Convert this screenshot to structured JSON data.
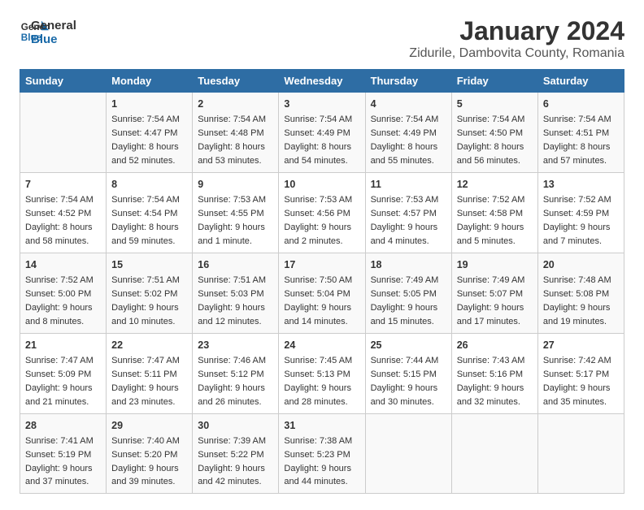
{
  "header": {
    "logo_line1": "General",
    "logo_line2": "Blue",
    "main_title": "January 2024",
    "subtitle": "Zidurile, Dambovita County, Romania"
  },
  "days_of_week": [
    "Sunday",
    "Monday",
    "Tuesday",
    "Wednesday",
    "Thursday",
    "Friday",
    "Saturday"
  ],
  "weeks": [
    [
      {
        "day": "",
        "content": ""
      },
      {
        "day": "1",
        "content": "Sunrise: 7:54 AM\nSunset: 4:47 PM\nDaylight: 8 hours\nand 52 minutes."
      },
      {
        "day": "2",
        "content": "Sunrise: 7:54 AM\nSunset: 4:48 PM\nDaylight: 8 hours\nand 53 minutes."
      },
      {
        "day": "3",
        "content": "Sunrise: 7:54 AM\nSunset: 4:49 PM\nDaylight: 8 hours\nand 54 minutes."
      },
      {
        "day": "4",
        "content": "Sunrise: 7:54 AM\nSunset: 4:49 PM\nDaylight: 8 hours\nand 55 minutes."
      },
      {
        "day": "5",
        "content": "Sunrise: 7:54 AM\nSunset: 4:50 PM\nDaylight: 8 hours\nand 56 minutes."
      },
      {
        "day": "6",
        "content": "Sunrise: 7:54 AM\nSunset: 4:51 PM\nDaylight: 8 hours\nand 57 minutes."
      }
    ],
    [
      {
        "day": "7",
        "content": "Sunrise: 7:54 AM\nSunset: 4:52 PM\nDaylight: 8 hours\nand 58 minutes."
      },
      {
        "day": "8",
        "content": "Sunrise: 7:54 AM\nSunset: 4:54 PM\nDaylight: 8 hours\nand 59 minutes."
      },
      {
        "day": "9",
        "content": "Sunrise: 7:53 AM\nSunset: 4:55 PM\nDaylight: 9 hours\nand 1 minute."
      },
      {
        "day": "10",
        "content": "Sunrise: 7:53 AM\nSunset: 4:56 PM\nDaylight: 9 hours\nand 2 minutes."
      },
      {
        "day": "11",
        "content": "Sunrise: 7:53 AM\nSunset: 4:57 PM\nDaylight: 9 hours\nand 4 minutes."
      },
      {
        "day": "12",
        "content": "Sunrise: 7:52 AM\nSunset: 4:58 PM\nDaylight: 9 hours\nand 5 minutes."
      },
      {
        "day": "13",
        "content": "Sunrise: 7:52 AM\nSunset: 4:59 PM\nDaylight: 9 hours\nand 7 minutes."
      }
    ],
    [
      {
        "day": "14",
        "content": "Sunrise: 7:52 AM\nSunset: 5:00 PM\nDaylight: 9 hours\nand 8 minutes."
      },
      {
        "day": "15",
        "content": "Sunrise: 7:51 AM\nSunset: 5:02 PM\nDaylight: 9 hours\nand 10 minutes."
      },
      {
        "day": "16",
        "content": "Sunrise: 7:51 AM\nSunset: 5:03 PM\nDaylight: 9 hours\nand 12 minutes."
      },
      {
        "day": "17",
        "content": "Sunrise: 7:50 AM\nSunset: 5:04 PM\nDaylight: 9 hours\nand 14 minutes."
      },
      {
        "day": "18",
        "content": "Sunrise: 7:49 AM\nSunset: 5:05 PM\nDaylight: 9 hours\nand 15 minutes."
      },
      {
        "day": "19",
        "content": "Sunrise: 7:49 AM\nSunset: 5:07 PM\nDaylight: 9 hours\nand 17 minutes."
      },
      {
        "day": "20",
        "content": "Sunrise: 7:48 AM\nSunset: 5:08 PM\nDaylight: 9 hours\nand 19 minutes."
      }
    ],
    [
      {
        "day": "21",
        "content": "Sunrise: 7:47 AM\nSunset: 5:09 PM\nDaylight: 9 hours\nand 21 minutes."
      },
      {
        "day": "22",
        "content": "Sunrise: 7:47 AM\nSunset: 5:11 PM\nDaylight: 9 hours\nand 23 minutes."
      },
      {
        "day": "23",
        "content": "Sunrise: 7:46 AM\nSunset: 5:12 PM\nDaylight: 9 hours\nand 26 minutes."
      },
      {
        "day": "24",
        "content": "Sunrise: 7:45 AM\nSunset: 5:13 PM\nDaylight: 9 hours\nand 28 minutes."
      },
      {
        "day": "25",
        "content": "Sunrise: 7:44 AM\nSunset: 5:15 PM\nDaylight: 9 hours\nand 30 minutes."
      },
      {
        "day": "26",
        "content": "Sunrise: 7:43 AM\nSunset: 5:16 PM\nDaylight: 9 hours\nand 32 minutes."
      },
      {
        "day": "27",
        "content": "Sunrise: 7:42 AM\nSunset: 5:17 PM\nDaylight: 9 hours\nand 35 minutes."
      }
    ],
    [
      {
        "day": "28",
        "content": "Sunrise: 7:41 AM\nSunset: 5:19 PM\nDaylight: 9 hours\nand 37 minutes."
      },
      {
        "day": "29",
        "content": "Sunrise: 7:40 AM\nSunset: 5:20 PM\nDaylight: 9 hours\nand 39 minutes."
      },
      {
        "day": "30",
        "content": "Sunrise: 7:39 AM\nSunset: 5:22 PM\nDaylight: 9 hours\nand 42 minutes."
      },
      {
        "day": "31",
        "content": "Sunrise: 7:38 AM\nSunset: 5:23 PM\nDaylight: 9 hours\nand 44 minutes."
      },
      {
        "day": "",
        "content": ""
      },
      {
        "day": "",
        "content": ""
      },
      {
        "day": "",
        "content": ""
      }
    ]
  ]
}
